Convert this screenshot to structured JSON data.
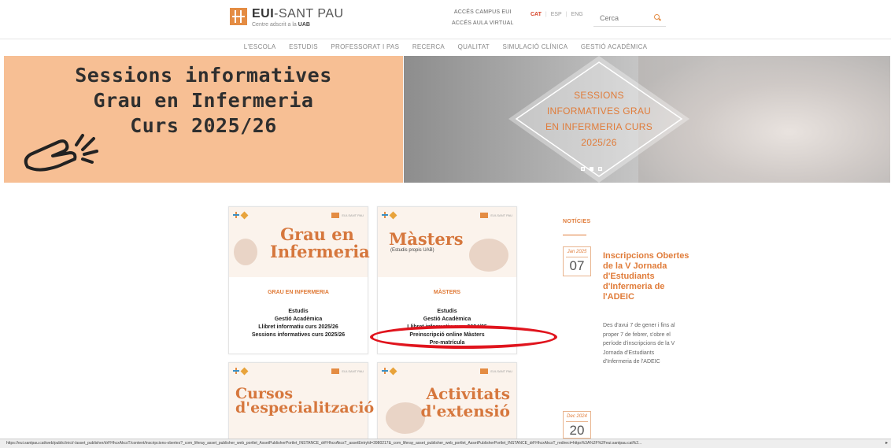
{
  "header": {
    "logo_title_bold": "EUI",
    "logo_title_rest": "-SANT PAU",
    "logo_sub": "Centre adscrit a la",
    "logo_sub_bold": "UAB",
    "access_links": [
      "ACCÉS CAMPUS EUI",
      "ACCÉS AULA VIRTUAL"
    ],
    "languages": [
      "CAT",
      "ESP",
      "ENG"
    ],
    "active_language": "CAT",
    "search_placeholder": "Cerca",
    "search_icon": "search-icon"
  },
  "nav": {
    "items": [
      "L'ESCOLA",
      "ESTUDIS",
      "PROFESSORAT I PAS",
      "RECERCA",
      "QUALITAT",
      "SIMULACIÓ CLÍNICA",
      "GESTIÓ ACADÈMICA"
    ]
  },
  "banner": {
    "lines": [
      "Sessions informatives",
      "Grau en Infermeria",
      "Curs 2025/26"
    ],
    "caption_lines": [
      "SESSIONS",
      "INFORMATIVES GRAU",
      "EN INFERMERIA CURS",
      "2025/26"
    ],
    "slides": 3,
    "active_slide": 2,
    "colors": {
      "left_bg": "#f7bf94",
      "caption": "#e07c3a"
    }
  },
  "cards": [
    {
      "title_lines": [
        "Grau en",
        "Infermeria"
      ],
      "name": "GRAU EN INFERMERIA",
      "links": [
        "Estudis",
        "Gestió Acadèmica",
        "Llibret informatiu curs 2025/26",
        "Sessions informatives curs 2025/26"
      ]
    },
    {
      "title_lines": [
        "Màsters"
      ],
      "subtitle": "(Estudis propis UAB)",
      "name": "MÀSTERS",
      "links": [
        "Estudis",
        "Gestió Acadèmica",
        "Llibret informatiu curs 2024/25",
        "Preinscripció online Màsters",
        "Pre-matrícula"
      ]
    },
    {
      "title_lines": [
        "Cursos",
        "d'especialització"
      ]
    },
    {
      "title_lines": [
        "Activitats",
        "d'extensió"
      ]
    }
  ],
  "news": {
    "heading": "NOTÍCIES",
    "items": [
      {
        "month": "Jan 2025",
        "day": "07",
        "title": "Inscripcions Obertes de la V Jornada d'Estudiants d'Infermeria de l'ADEIC",
        "body": "Des d'avui 7 de gener i fins al proper 7 de febrer, s'obre el període d'inscripcions de la V Jornada d'Estudiants d'Infermeria de l'ADEIC"
      },
      {
        "month": "Dec 2024",
        "day": "20"
      }
    ]
  },
  "statusbar": {
    "url": "https://eui.santpau.cat/web/public/inici/-/asset_publisher/drFHhcxAkcsT/content/inscripcions-obertes?_com_liferay_asset_publisher_web_portlet_AssetPublisherPortlet_INSTANCE_drFHhcxAkcsT_assetEntryId=3980217&_com_liferay_asset_publisher_web_portlet_AssetPublisherPortlet_INSTANCE_drFHhcxAkcsT_redirect=https%3A%2F%2Feui.santpau.cat%2..."
  },
  "highlight_color": "#e0141d"
}
